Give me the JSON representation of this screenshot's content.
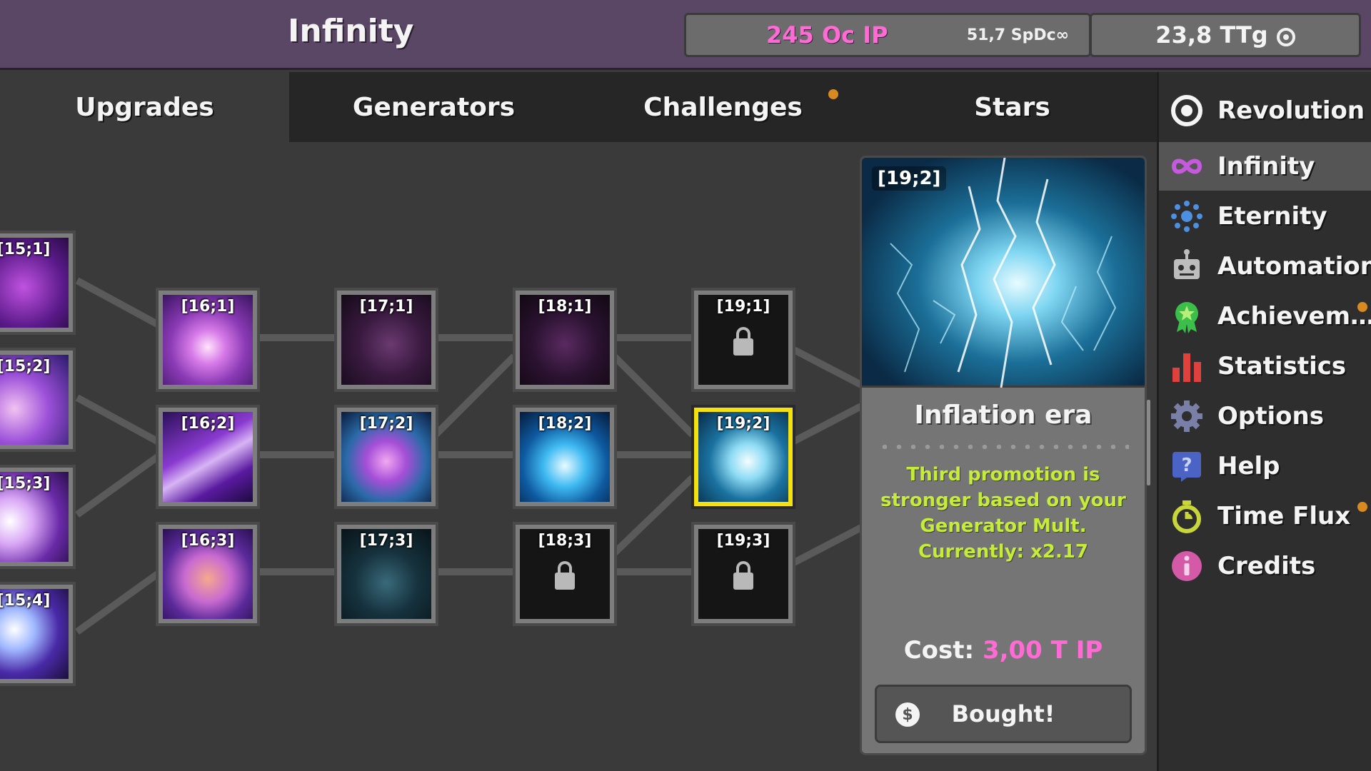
{
  "header": {
    "title": "Infinity",
    "ip_amount": "245 Oc IP",
    "ip_rate": "51,7 SpDc∞",
    "time_amount": "23,8 TTg"
  },
  "tabs": [
    {
      "label": "Upgrades",
      "active": true,
      "notification": false
    },
    {
      "label": "Generators",
      "active": false,
      "notification": false
    },
    {
      "label": "Challenges",
      "active": false,
      "notification": true
    },
    {
      "label": "Stars",
      "active": false,
      "notification": false
    }
  ],
  "nav": {
    "items": [
      {
        "label": "Revolution",
        "icon": "target-icon",
        "active": false,
        "notification": false
      },
      {
        "label": "Infinity",
        "icon": "infinity-icon",
        "active": true,
        "notification": false
      },
      {
        "label": "Eternity",
        "icon": "eternity-icon",
        "active": false,
        "notification": false
      },
      {
        "label": "Automations",
        "icon": "robot-icon",
        "active": false,
        "notification": false
      },
      {
        "label": "Achievem…",
        "icon": "award-icon",
        "active": false,
        "notification": true
      },
      {
        "label": "Statistics",
        "icon": "bar-chart-icon",
        "active": false,
        "notification": false
      },
      {
        "label": "Options",
        "icon": "gear-icon",
        "active": false,
        "notification": false
      },
      {
        "label": "Help",
        "icon": "question-icon",
        "active": false,
        "notification": false
      },
      {
        "label": "Time Flux",
        "icon": "stopwatch-icon",
        "active": false,
        "notification": true
      },
      {
        "label": "Credits",
        "icon": "info-icon",
        "active": false,
        "notification": false
      }
    ]
  },
  "upgrades": {
    "col15": [
      "[15;1]",
      "[15;2]",
      "[15;3]",
      "[15;4]"
    ],
    "col16": [
      "[16;1]",
      "[16;2]",
      "[16;3]"
    ],
    "col17": [
      "[17;1]",
      "[17;2]",
      "[17;3]"
    ],
    "col18": [
      "[18;1]",
      "[18;2]",
      "[18;3]"
    ],
    "col19": [
      "[19;1]",
      "[19;2]",
      "[19;3]"
    ]
  },
  "detail": {
    "tag": "[19;2]",
    "title": "Inflation era",
    "description": "Third promotion is stronger based on your Generator Mult. Currently: x2.17",
    "cost_label": "Cost:",
    "cost_value": "3,00 T IP",
    "button_label": "Bought!",
    "coin_symbol": "$"
  },
  "colors": {
    "accent_ip": "#ff6ad5",
    "description": "#c6ec3a",
    "selected_border": "#f4e10e",
    "notification": "#d98a1e"
  }
}
